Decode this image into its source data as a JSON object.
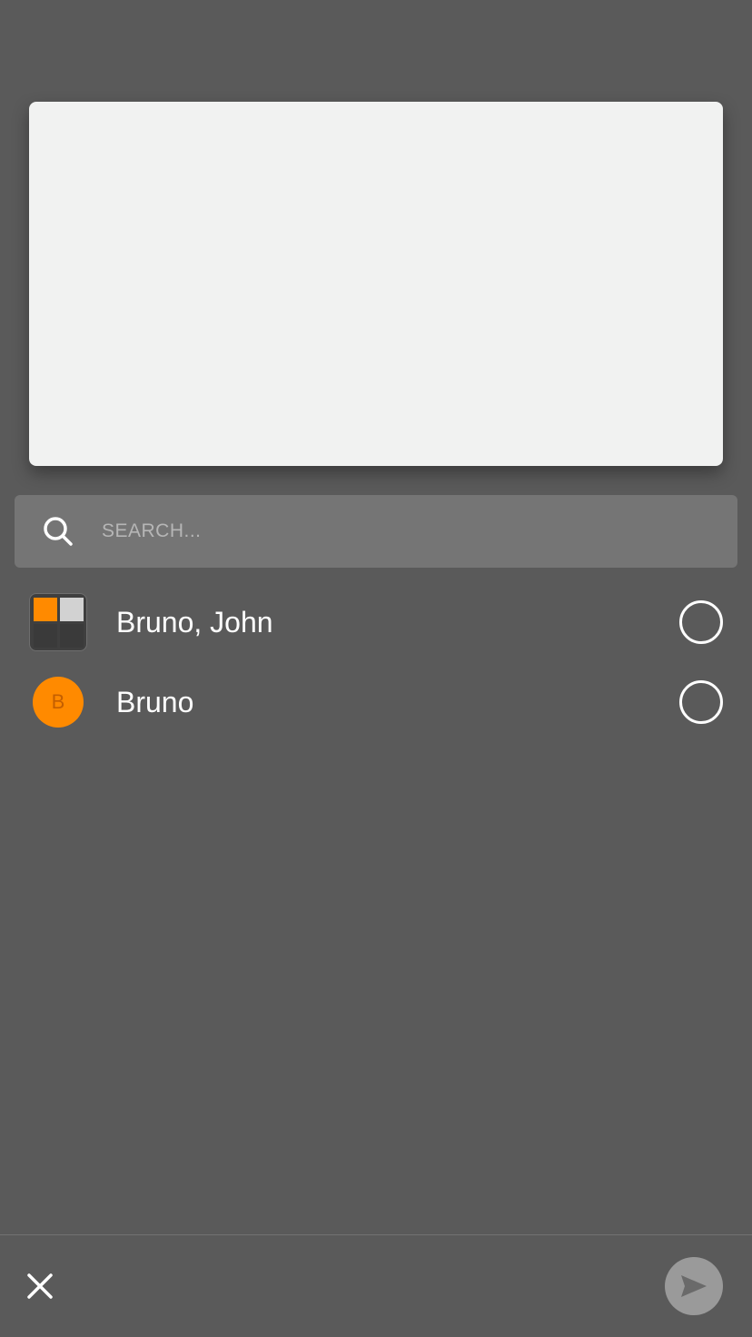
{
  "search": {
    "placeholder": "SEARCH...",
    "value": "",
    "icon": "search-icon"
  },
  "contacts": [
    {
      "name": "Bruno, John",
      "avatar_type": "group-grid",
      "avatar_colors": [
        "#ff8a00",
        "#d2d2d2",
        "#3a3a3a",
        "#3a3a3a"
      ],
      "selected": false
    },
    {
      "name": "Bruno",
      "avatar_type": "initial",
      "initial": "B",
      "avatar_color": "#ff8a00",
      "selected": false
    }
  ],
  "bottom_bar": {
    "close_icon": "close-icon",
    "send_icon": "send-icon",
    "send_enabled": false
  },
  "colors": {
    "background": "#5a5a5a",
    "preview_card": "#f1f2f1",
    "search_bar": "#757575",
    "accent": "#ff8a00",
    "send_button_disabled": "#9a9a9a"
  }
}
